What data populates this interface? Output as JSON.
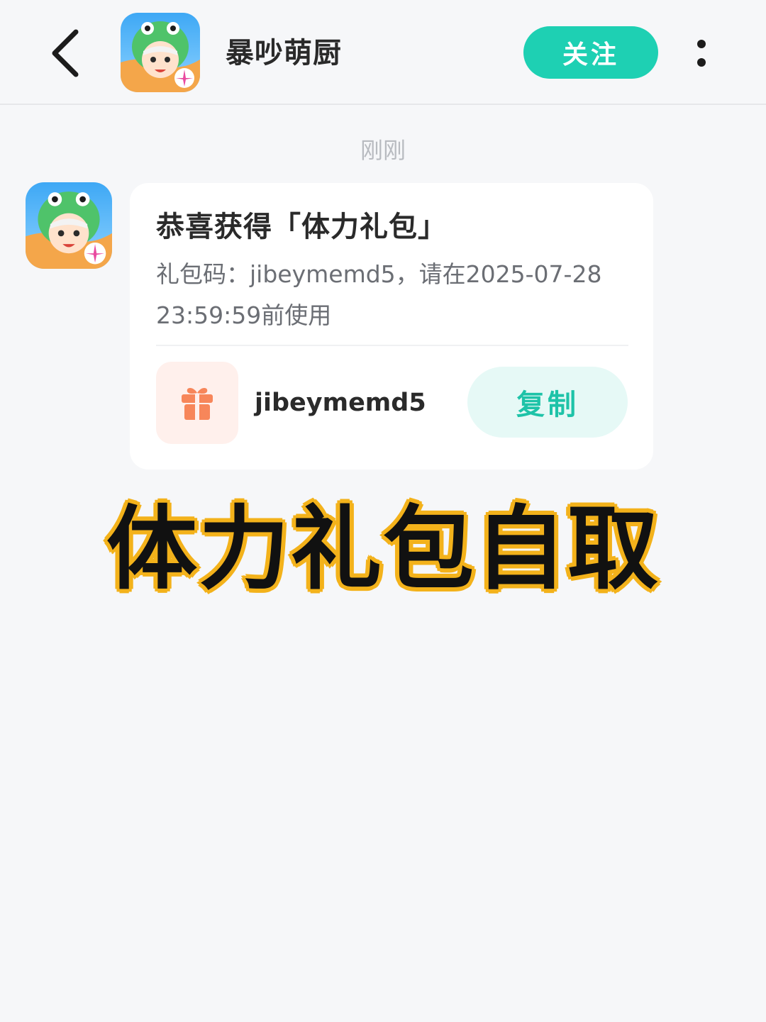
{
  "header": {
    "title": "暴吵萌厨",
    "follow_label": "关注",
    "back_icon": "chevron-left-icon",
    "more_icon": "more-vertical-icon",
    "accent_color": "#1ed0b3"
  },
  "message": {
    "timestamp": "刚刚",
    "title": "恭喜获得「体力礼包」",
    "description": "礼包码：jibeymemd5，请在2025-07-28 23:59:59前使用",
    "gift_icon": "gift-icon",
    "gift_code": "jibeymemd5",
    "copy_label": "复制"
  },
  "overlay": {
    "caption": "体力礼包自取",
    "caption_color": "#111111",
    "caption_outline_color": "#f3b21b"
  }
}
